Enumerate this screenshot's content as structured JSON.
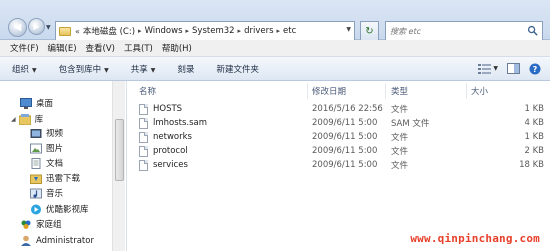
{
  "address": {
    "lead": "«",
    "crumbs": [
      "本地磁盘 (C:)",
      "Windows",
      "System32",
      "drivers",
      "etc"
    ]
  },
  "search": {
    "placeholder": "搜索 etc"
  },
  "menu": [
    "文件(F)",
    "编辑(E)",
    "查看(V)",
    "工具(T)",
    "帮助(H)"
  ],
  "commands": {
    "organize": "组织",
    "include_library": "包含到库中",
    "share": "共享",
    "burn": "刻录",
    "new_folder": "新建文件夹"
  },
  "nav": {
    "desktop": "桌面",
    "library": "库",
    "video": "视频",
    "pictures": "图片",
    "documents": "文档",
    "xunlei": "迅雷下载",
    "music": "音乐",
    "youku": "优酷影视库",
    "homegroup": "家庭组",
    "user": "Administrator"
  },
  "columns": {
    "name": "名称",
    "date": "修改日期",
    "type": "类型",
    "size": "大小"
  },
  "files": [
    {
      "name": "HOSTS",
      "date": "2016/5/16 22:56",
      "type": "文件",
      "size": "1 KB"
    },
    {
      "name": "lmhosts.sam",
      "date": "2009/6/11 5:00",
      "type": "SAM 文件",
      "size": "4 KB"
    },
    {
      "name": "networks",
      "date": "2009/6/11 5:00",
      "type": "文件",
      "size": "1 KB"
    },
    {
      "name": "protocol",
      "date": "2009/6/11 5:00",
      "type": "文件",
      "size": "2 KB"
    },
    {
      "name": "services",
      "date": "2009/6/11 5:00",
      "type": "文件",
      "size": "18 KB"
    }
  ],
  "watermark": "www.qinpinchang.com",
  "colors": {
    "accent": "#1e2c44",
    "watermark": "#e8402a",
    "header_text": "#4b5a78"
  }
}
